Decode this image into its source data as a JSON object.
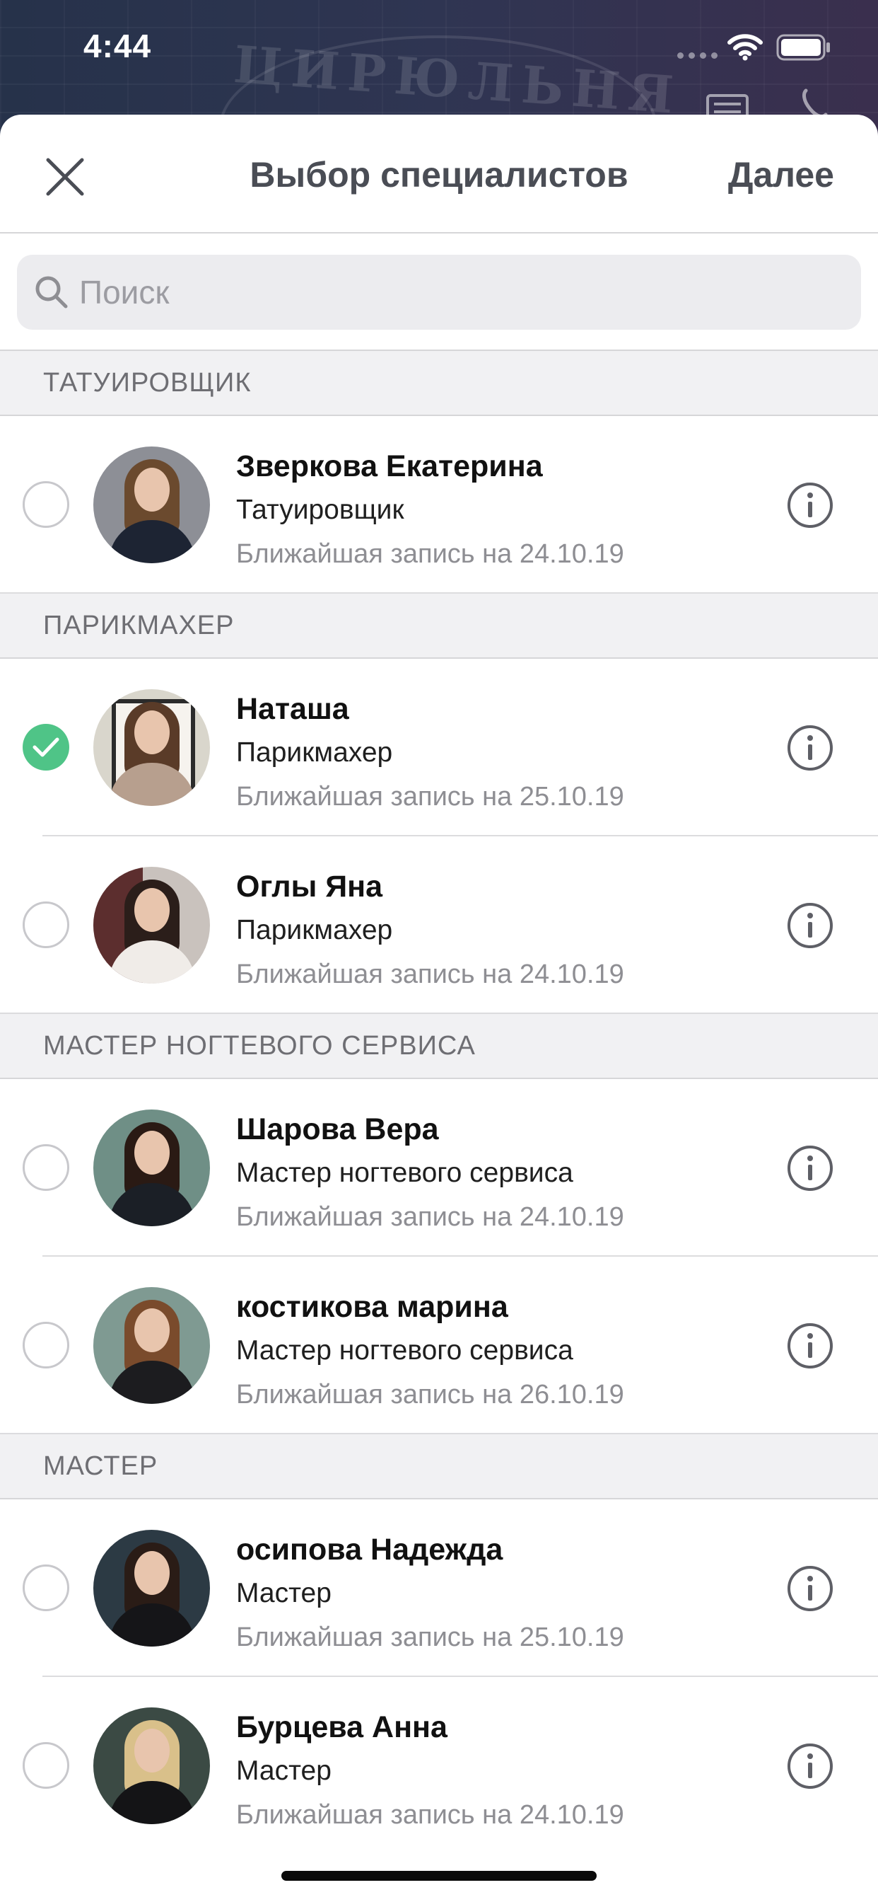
{
  "status_bar": {
    "time": "4:44"
  },
  "background": {
    "brand_text": "ЦИРЮЛЬНЯ"
  },
  "nav": {
    "title": "Выбор специалистов",
    "next_label": "Далее"
  },
  "search": {
    "placeholder": "Поиск"
  },
  "sections": [
    {
      "header": "ТАТУИРОВЩИК",
      "rows": [
        {
          "name": "Зверкова Екатерина",
          "role": "Татуировщик",
          "next": "Ближайшая запись на 24.10.19",
          "checked": false
        }
      ]
    },
    {
      "header": "ПАРИКМАХЕР",
      "rows": [
        {
          "name": "Наташа",
          "role": "Парикмахер",
          "next": "Ближайшая запись на 25.10.19",
          "checked": true
        },
        {
          "name": "Оглы Яна",
          "role": "Парикмахер",
          "next": "Ближайшая запись на 24.10.19",
          "checked": false
        }
      ]
    },
    {
      "header": "МАСТЕР НОГТЕВОГО СЕРВИСА",
      "rows": [
        {
          "name": "Шарова Вера",
          "role": "Мастер ногтевого сервиса",
          "next": "Ближайшая запись на 24.10.19",
          "checked": false
        },
        {
          "name": "костикова марина",
          "role": "Мастер ногтевого сервиса",
          "next": "Ближайшая запись на 26.10.19",
          "checked": false
        }
      ]
    },
    {
      "header": "МАСТЕР",
      "rows": [
        {
          "name": "осипова Надежда",
          "role": "Мастер",
          "next": "Ближайшая запись на 25.10.19",
          "checked": false
        },
        {
          "name": "Бурцева Анна",
          "role": "Мастер",
          "next": "Ближайшая запись на 24.10.19",
          "checked": false
        }
      ]
    }
  ],
  "colors": {
    "accent_check": "#4fc487",
    "title_gray": "#4a4d55",
    "section_bg": "#f1f1f3"
  }
}
